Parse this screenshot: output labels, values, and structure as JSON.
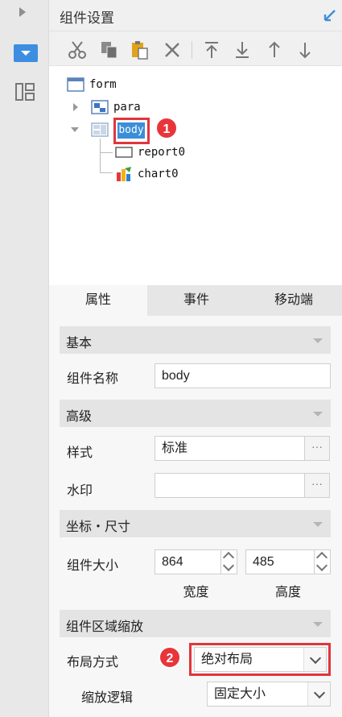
{
  "panel": {
    "title": "组件设置"
  },
  "toolbar": {
    "icons": [
      "cut-icon",
      "copy-icon",
      "paste-icon",
      "delete-icon",
      "move-top-icon",
      "move-bottom-icon",
      "move-up-icon",
      "move-down-icon"
    ]
  },
  "tree": {
    "root": "form",
    "nodes": [
      {
        "label": "para",
        "expanded": false
      },
      {
        "label": "body",
        "expanded": true,
        "selected": true
      },
      {
        "label": "report0"
      },
      {
        "label": "chart0"
      }
    ]
  },
  "callouts": {
    "one": "1",
    "two": "2"
  },
  "tabs": [
    {
      "label": "属性",
      "active": true
    },
    {
      "label": "事件",
      "active": false
    },
    {
      "label": "移动端",
      "active": false
    }
  ],
  "sections": {
    "basic": "基本",
    "advanced": "高级",
    "coords": "坐标・尺寸",
    "zoom": "组件区域缩放"
  },
  "props": {
    "name_label": "组件名称",
    "name_value": "body",
    "style_label": "样式",
    "style_value": "标准",
    "watermark_label": "水印",
    "watermark_value": "",
    "ellipsis": "···",
    "size_label": "组件大小",
    "width_value": "864",
    "height_value": "485",
    "width_caption": "宽度",
    "height_caption": "高度",
    "layout_label": "布局方式",
    "layout_value": "绝对布局",
    "scale_label": "缩放逻辑",
    "scale_value": "固定大小"
  },
  "colors": {
    "accent": "#3b8fd8",
    "callout": "#e8353b",
    "section_bg": "#e4e4e4"
  }
}
